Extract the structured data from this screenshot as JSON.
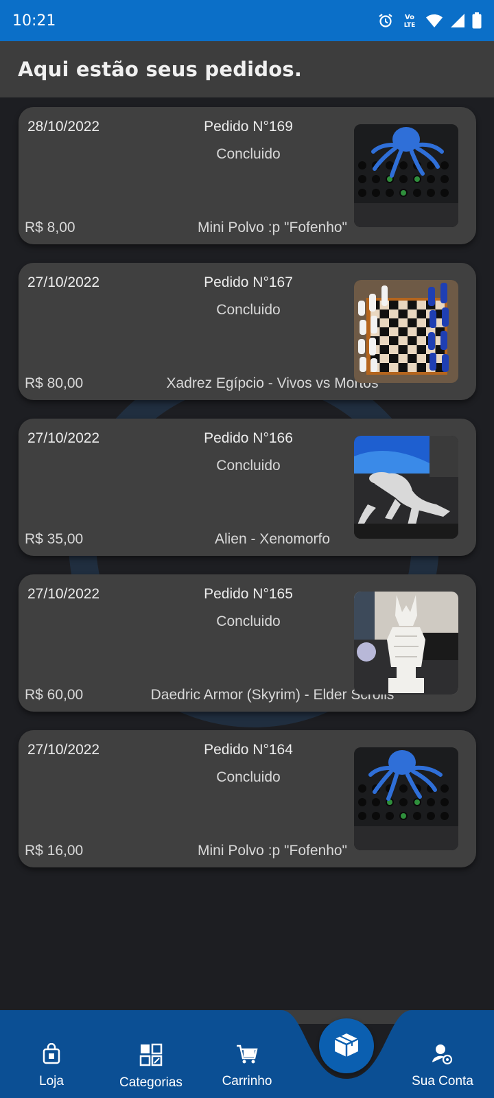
{
  "status_bar": {
    "time": "10:21",
    "icons": [
      "alarm-icon",
      "volte-icon",
      "wifi-icon",
      "signal-icon",
      "battery-icon"
    ],
    "color": "#0b6fc8"
  },
  "header": {
    "title": "Aqui estão seus pedidos."
  },
  "orders": [
    {
      "date": "28/10/2022",
      "number": "Pedido N°169",
      "status": "Concluido",
      "price": "R$ 8,00",
      "product": "Mini Polvo :p \"Fofenho\"",
      "image": "octopus"
    },
    {
      "date": "27/10/2022",
      "number": "Pedido N°167",
      "status": "Concluido",
      "price": "R$ 80,00",
      "product": "Xadrez Egípcio - Vivos vs Mortos",
      "image": "chess"
    },
    {
      "date": "27/10/2022",
      "number": "Pedido N°166",
      "status": "Concluido",
      "price": "R$ 35,00",
      "product": "Alien - Xenomorfo",
      "image": "alien"
    },
    {
      "date": "27/10/2022",
      "number": "Pedido N°165",
      "status": "Concluido",
      "price": "R$ 60,00",
      "product": "Daedric Armor (Skyrim) - Elder Scrolls",
      "image": "armor"
    },
    {
      "date": "27/10/2022",
      "number": "Pedido N°164",
      "status": "Concluido",
      "price": "R$ 16,00",
      "product": "Mini Polvo :p \"Fofenho\"",
      "image": "octopus"
    }
  ],
  "bottom_nav": {
    "items": [
      {
        "label": "Loja",
        "icon": "store-bag-icon"
      },
      {
        "label": "Categorias",
        "icon": "categories-grid-icon"
      },
      {
        "label": "Carrinho",
        "icon": "cart-icon"
      },
      {
        "label": "Sua Conta",
        "icon": "account-icon"
      }
    ],
    "center_icon": "orders-box-icon",
    "accent": "#0b5fb0"
  }
}
